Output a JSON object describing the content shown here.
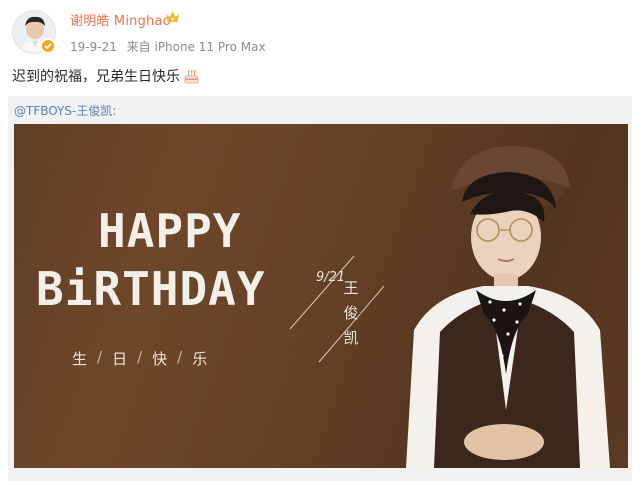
{
  "post": {
    "author": "谢明皓 Minghao",
    "date": "19-9-21",
    "source": "来自 iPhone 11 Pro Max",
    "text": "迟到的祝福，兄弟生日快乐",
    "icons": [
      "crown-icon",
      "verified-badge-icon",
      "cake-emoji-icon"
    ]
  },
  "repost": {
    "author": "@TFBOYS-王俊凯:",
    "image": {
      "line1": "HAPPY",
      "line2": "BiRTHDAY",
      "cn": [
        "生",
        "日",
        "快",
        "乐"
      ],
      "separator": "/",
      "date": "9/21",
      "name": [
        "王",
        "俊",
        "凯"
      ]
    }
  },
  "colors": {
    "username": "#eb7350",
    "link": "#5780b5",
    "meta": "#8c8c8c",
    "repost_bg": "#f2f2f2",
    "photo_brown": "#5e3c24"
  }
}
